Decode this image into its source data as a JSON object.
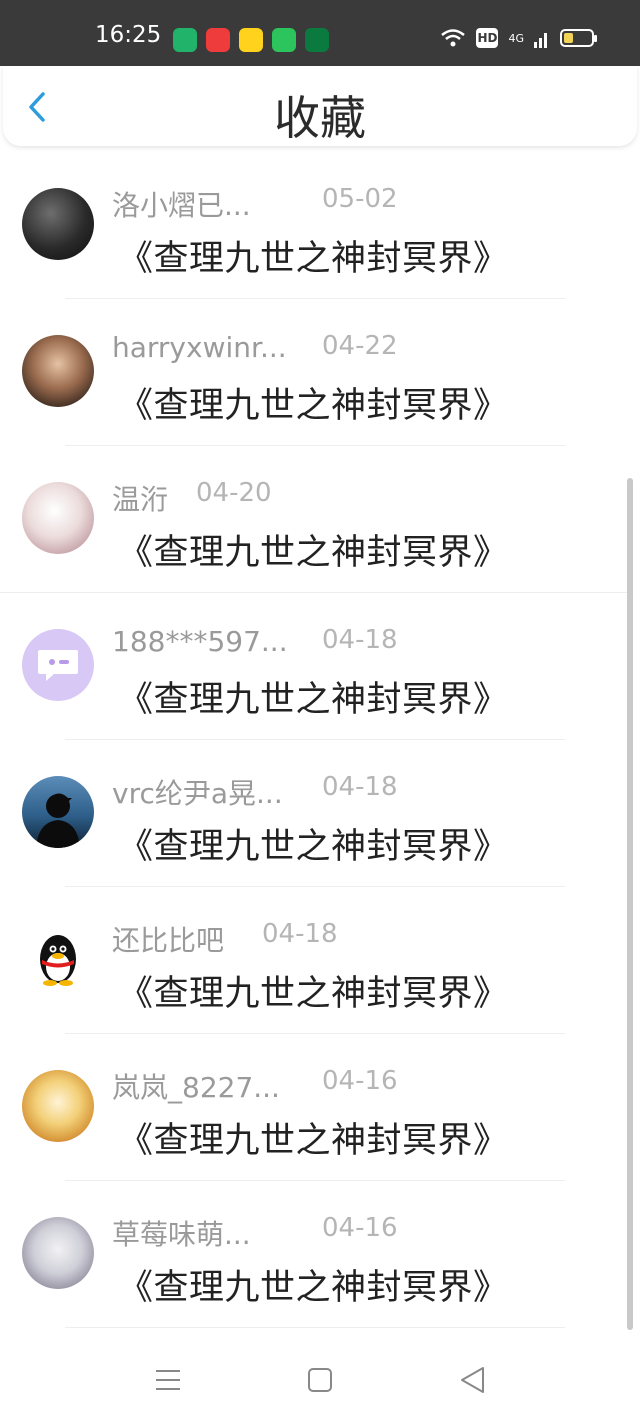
{
  "status_bar": {
    "time": "16:25",
    "network": "4G",
    "hd": "HD",
    "battery_level": 0.35,
    "app_icons": [
      {
        "name": "video-app-icon",
        "color": "#22b36b"
      },
      {
        "name": "play-app-icon",
        "color": "#ee3b3b"
      },
      {
        "name": "chat-app-icon",
        "color": "#ffd21e"
      },
      {
        "name": "store-app-icon",
        "color": "#2cc45d"
      },
      {
        "name": "oppo-app-icon",
        "color": "#0b7a3e"
      }
    ]
  },
  "header": {
    "title": "收藏"
  },
  "items": [
    {
      "username": "洛小熠已...",
      "date": "05-02",
      "title": "《查理九世之神封冥界》",
      "avatar": "dark-portrait"
    },
    {
      "username": "harryxwinr...",
      "date": "04-22",
      "title": "《查理九世之神封冥界》",
      "avatar": "girl-photo"
    },
    {
      "username": "温洐",
      "date": "04-20",
      "title": "《查理九世之神封冥界》",
      "avatar": "anime-white-hair"
    },
    {
      "username": "188***597...",
      "date": "04-18",
      "title": "《查理九世之神封冥界》",
      "avatar": "default-chat"
    },
    {
      "username": "vrc纶尹a晃...",
      "date": "04-18",
      "title": "《查理九世之神封冥界》",
      "avatar": "silhouette"
    },
    {
      "username": "还比比吧",
      "date": "04-18",
      "title": "《查理九世之神封冥界》",
      "avatar": "qq-penguin"
    },
    {
      "username": "岚岚_8227...",
      "date": "04-16",
      "title": "《查理九世之神封冥界》",
      "avatar": "anime-blonde"
    },
    {
      "username": "草莓味萌...",
      "date": "04-16",
      "title": "《查理九世之神封冥界》",
      "avatar": "anime-silver"
    }
  ],
  "colors": {
    "status_bar_bg": "#3a3a3a",
    "accent": "#2d9cdb",
    "username": "#9a9a9a",
    "date": "#b5b5b5",
    "title": "#222222"
  }
}
